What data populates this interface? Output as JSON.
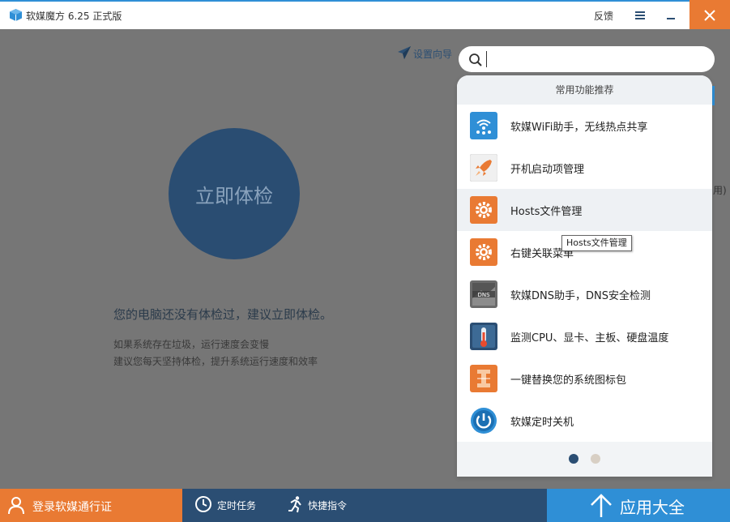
{
  "titlebar": {
    "app_title": "软媒魔方 6.25 正式版",
    "feedback": "反馈"
  },
  "main": {
    "wizard_label": "设置向导",
    "check_button": "立即体检",
    "message_main": "您的电脑还没有体检过，建议立即体检。",
    "message_sub1": "如果系统存在垃圾，运行速度会变慢",
    "message_sub2": "建议您每天坚持体检，提升系统运行速度和效率",
    "right_edge_text": "用)"
  },
  "search": {
    "value": "",
    "placeholder": ""
  },
  "dropdown": {
    "header": "常用功能推荐",
    "items": [
      {
        "label": "软媒WiFi助手，无线热点共享",
        "icon": "wifi-share-icon"
      },
      {
        "label": "开机启动项管理",
        "icon": "rocket-icon"
      },
      {
        "label": "Hosts文件管理",
        "icon": "gear-icon"
      },
      {
        "label": "右键关联菜单",
        "icon": "gear-icon"
      },
      {
        "label": "软媒DNS助手，DNS安全检测",
        "icon": "dns-icon"
      },
      {
        "label": "监测CPU、显卡、主板、硬盘温度",
        "icon": "thermometer-icon"
      },
      {
        "label": "一键替换您的系统图标包",
        "icon": "icon-pack-icon"
      },
      {
        "label": "软媒定时关机",
        "icon": "power-icon"
      }
    ],
    "active_page": 1,
    "page_count": 2
  },
  "tooltip": "Hosts文件管理",
  "bottombar": {
    "login": "登录软媒通行证",
    "scheduled_tasks": "定时任务",
    "quick_commands": "快捷指令",
    "app_store": "应用大全"
  },
  "colors": {
    "accent_orange": "#e97a33",
    "accent_blue": "#2f8fd6",
    "navy": "#2b4e73"
  }
}
